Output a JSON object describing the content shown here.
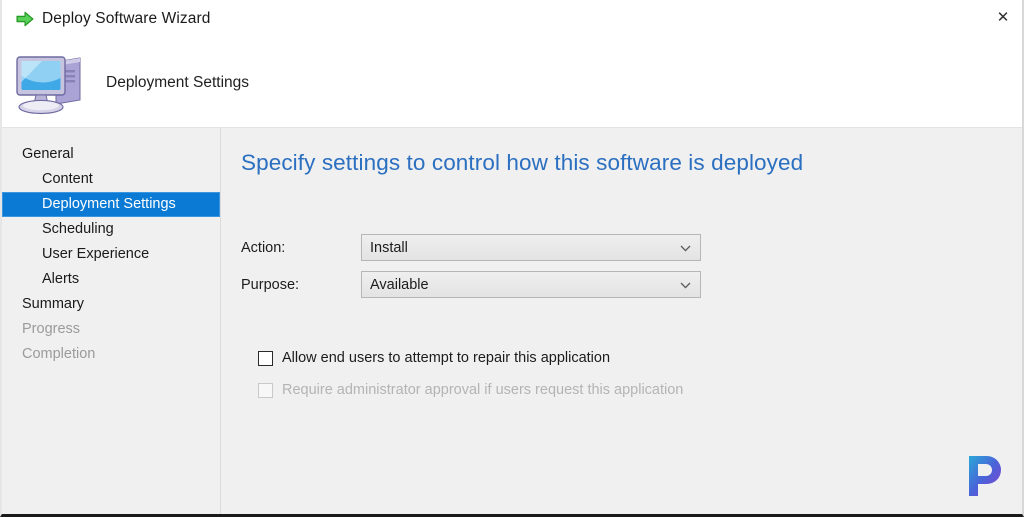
{
  "window": {
    "title": "Deploy Software Wizard",
    "close_label": "✕",
    "arrow_icon": "green-right-arrow",
    "header_title": "Deployment Settings",
    "header_icon": "computer-monitor-icon"
  },
  "sidebar": {
    "items": [
      {
        "label": "General",
        "level": 0,
        "selected": false,
        "disabled": false
      },
      {
        "label": "Content",
        "level": 1,
        "selected": false,
        "disabled": false
      },
      {
        "label": "Deployment Settings",
        "level": 1,
        "selected": true,
        "disabled": false
      },
      {
        "label": "Scheduling",
        "level": 1,
        "selected": false,
        "disabled": false
      },
      {
        "label": "User Experience",
        "level": 1,
        "selected": false,
        "disabled": false
      },
      {
        "label": "Alerts",
        "level": 1,
        "selected": false,
        "disabled": false
      },
      {
        "label": "Summary",
        "level": 0,
        "selected": false,
        "disabled": false
      },
      {
        "label": "Progress",
        "level": 0,
        "selected": false,
        "disabled": true
      },
      {
        "label": "Completion",
        "level": 0,
        "selected": false,
        "disabled": true
      }
    ]
  },
  "content": {
    "heading": "Specify settings to control how this software is deployed",
    "fields": [
      {
        "label": "Action:",
        "value": "Install",
        "name": "action-dropdown"
      },
      {
        "label": "Purpose:",
        "value": "Available",
        "name": "purpose-dropdown"
      }
    ],
    "checkboxes": [
      {
        "label": "Allow end users to attempt to repair this application",
        "checked": false,
        "disabled": false,
        "name": "allow-repair-checkbox"
      },
      {
        "label": "Require administrator approval if users request this application",
        "checked": false,
        "disabled": true,
        "name": "require-approval-checkbox"
      }
    ]
  },
  "watermark": {
    "letter": "P"
  },
  "colors": {
    "selection_blue": "#0a7ad4",
    "heading_blue": "#2b6fc1",
    "body_background": "#f0f0f0",
    "titlebar_background": "#ffffff",
    "disabled_text": "#b4b4b4"
  }
}
